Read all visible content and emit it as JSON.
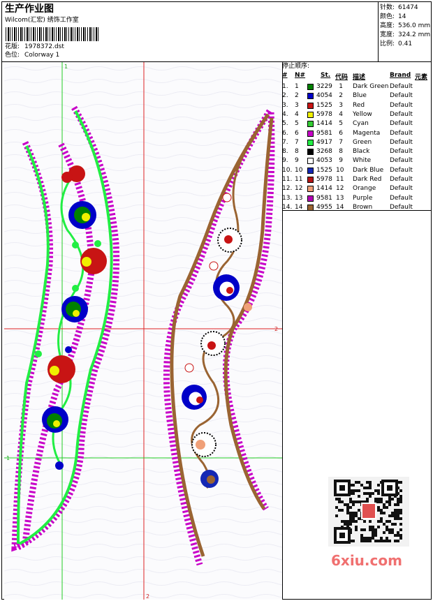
{
  "header": {
    "title": "生产作业图",
    "company": "Wilcom(汇宏) 绣饰工作室",
    "design_label": "花版:",
    "design_value": "1978372.dst",
    "colorway_label": "色位:",
    "colorway_value": "Colorway 1"
  },
  "stats": [
    {
      "label": "针数:",
      "value": "61474"
    },
    {
      "label": "颜色:",
      "value": "14"
    },
    {
      "label": "高度:",
      "value": "536.0 mm"
    },
    {
      "label": "宽度:",
      "value": "324.2 mm"
    },
    {
      "label": "比例:",
      "value": "0.41"
    }
  ],
  "stop_sequence": {
    "title": "停止顺序:",
    "columns": {
      "hash": "#",
      "no": "N#",
      "st": "St.",
      "code": "代码",
      "desc": "描述",
      "brand": "Brand",
      "element": "元素"
    },
    "rows": [
      {
        "n": "1.",
        "no": "1",
        "st": "3229",
        "code": "1",
        "desc": "Dark Green",
        "brand": "Default",
        "color": "#008000"
      },
      {
        "n": "2.",
        "no": "2",
        "st": "4054",
        "code": "2",
        "desc": "Blue",
        "brand": "Default",
        "color": "#0000c8"
      },
      {
        "n": "3.",
        "no": "3",
        "st": "1525",
        "code": "3",
        "desc": "Red",
        "brand": "Default",
        "color": "#c81414"
      },
      {
        "n": "4.",
        "no": "4",
        "st": "5978",
        "code": "4",
        "desc": "Yellow",
        "brand": "Default",
        "color": "#f0f000"
      },
      {
        "n": "5.",
        "no": "5",
        "st": "1414",
        "code": "5",
        "desc": "Cyan",
        "brand": "Default",
        "color": "#33cc33"
      },
      {
        "n": "6.",
        "no": "6",
        "st": "9581",
        "code": "6",
        "desc": "Magenta",
        "brand": "Default",
        "color": "#c800c8"
      },
      {
        "n": "7.",
        "no": "7",
        "st": "4917",
        "code": "7",
        "desc": "Green",
        "brand": "Default",
        "color": "#22ee44"
      },
      {
        "n": "8.",
        "no": "8",
        "st": "3268",
        "code": "8",
        "desc": "Black",
        "brand": "Default",
        "color": "#000000"
      },
      {
        "n": "9.",
        "no": "9",
        "st": "4053",
        "code": "9",
        "desc": "White",
        "brand": "Default",
        "color": "#ffffff"
      },
      {
        "n": "10.",
        "no": "10",
        "st": "1525",
        "code": "10",
        "desc": "Dark Blue",
        "brand": "Default",
        "color": "#1428b4"
      },
      {
        "n": "11.",
        "no": "11",
        "st": "5978",
        "code": "11",
        "desc": "Dark Red",
        "brand": "Default",
        "color": "#b41414"
      },
      {
        "n": "12.",
        "no": "12",
        "st": "1414",
        "code": "12",
        "desc": "Orange",
        "brand": "Default",
        "color": "#f0a078"
      },
      {
        "n": "13.",
        "no": "13",
        "st": "9581",
        "code": "13",
        "desc": "Purple",
        "brand": "Default",
        "color": "#b400b4"
      },
      {
        "n": "14.",
        "no": "14",
        "st": "4955",
        "code": "14",
        "desc": "Brown",
        "brand": "Default",
        "color": "#9a6432"
      }
    ]
  },
  "guides": {
    "v1": "1",
    "h2": "2",
    "h1": "1",
    "v2": "2"
  },
  "watermark": "6xiu.com"
}
